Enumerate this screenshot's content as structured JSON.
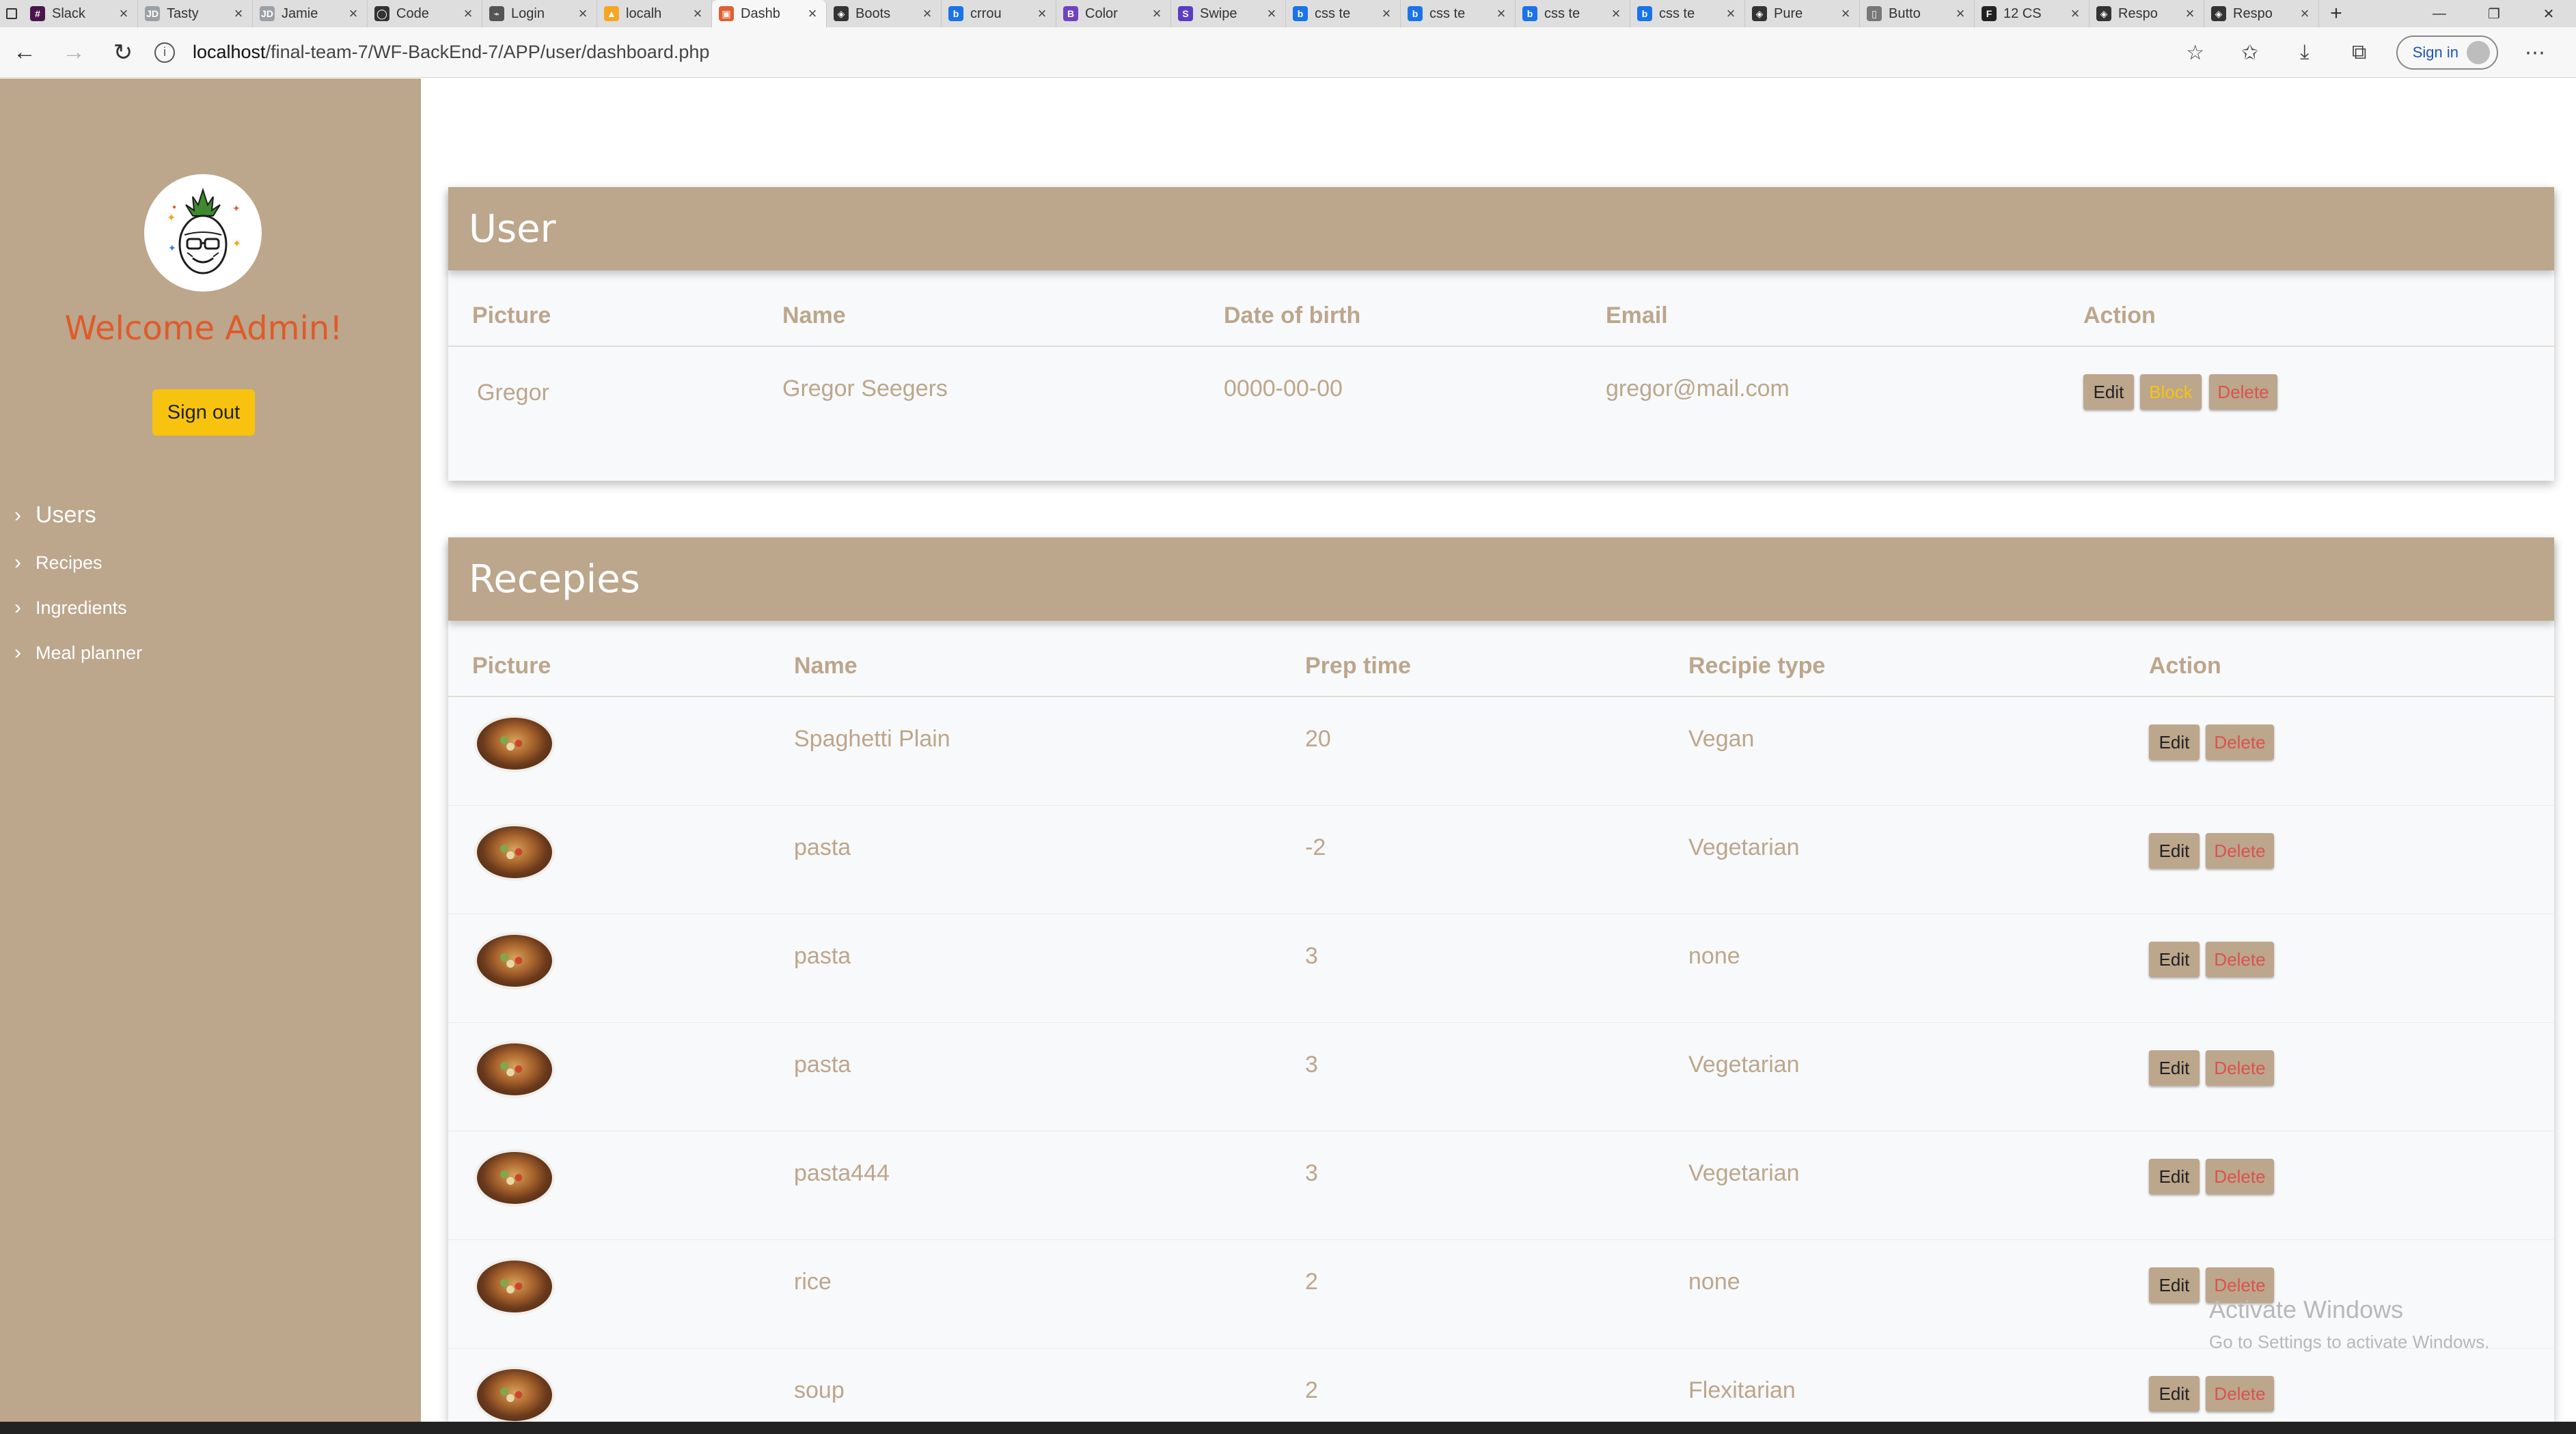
{
  "browser": {
    "tabs": [
      {
        "title": "Slack",
        "fav_color": "#4a154b",
        "fav_glyph": "#"
      },
      {
        "title": "Tasty",
        "fav_color": "#9aa0a6",
        "fav_glyph": "JD"
      },
      {
        "title": "Jamie",
        "fav_color": "#9aa0a6",
        "fav_glyph": "JD"
      },
      {
        "title": "Code",
        "fav_color": "#333333",
        "fav_glyph": "◯"
      },
      {
        "title": "Login",
        "fav_color": "#555555",
        "fav_glyph": "⌁"
      },
      {
        "title": "localh",
        "fav_color": "#f5a623",
        "fav_glyph": "▲"
      },
      {
        "title": "Dashb",
        "fav_color": "#e06030",
        "fav_glyph": "▣",
        "active": true
      },
      {
        "title": "Boots",
        "fav_color": "#333333",
        "fav_glyph": "◈"
      },
      {
        "title": "crrou",
        "fav_color": "#1a73e8",
        "fav_glyph": "b"
      },
      {
        "title": "Color",
        "fav_color": "#6f42c1",
        "fav_glyph": "B"
      },
      {
        "title": "Swipe",
        "fav_color": "#5b3cc4",
        "fav_glyph": "S"
      },
      {
        "title": "css te",
        "fav_color": "#1a73e8",
        "fav_glyph": "b"
      },
      {
        "title": "css te",
        "fav_color": "#1a73e8",
        "fav_glyph": "b"
      },
      {
        "title": "css te",
        "fav_color": "#1a73e8",
        "fav_glyph": "b"
      },
      {
        "title": "css te",
        "fav_color": "#1a73e8",
        "fav_glyph": "b"
      },
      {
        "title": "Pure",
        "fav_color": "#333333",
        "fav_glyph": "◈"
      },
      {
        "title": "Butto",
        "fav_color": "#777777",
        "fav_glyph": "▯"
      },
      {
        "title": "12 CS",
        "fav_color": "#222222",
        "fav_glyph": "F"
      },
      {
        "title": "Respo",
        "fav_color": "#333333",
        "fav_glyph": "◈"
      },
      {
        "title": "Respo",
        "fav_color": "#333333",
        "fav_glyph": "◈"
      }
    ],
    "url_host": "localhost",
    "url_path": "/final-team-7/WF-BackEnd-7/APP/user/dashboard.php",
    "signin_label": "Sign in"
  },
  "sidebar": {
    "welcome": "Welcome Admin!",
    "signout_label": "Sign out",
    "items": [
      {
        "label": "Users"
      },
      {
        "label": "Recipes"
      },
      {
        "label": "Ingredients"
      },
      {
        "label": "Meal planner"
      }
    ]
  },
  "users": {
    "title": "User",
    "headers": [
      "Picture",
      "Name",
      "Date of birth",
      "Email",
      "Action"
    ],
    "rows": [
      {
        "picture_alt": "Gregor",
        "name": "Gregor Seegers",
        "dob": "0000-00-00",
        "email": "gregor@mail.com",
        "edit": "Edit",
        "block": "Block",
        "delete": "Delete"
      }
    ]
  },
  "recipes": {
    "title": "Recepies",
    "headers": [
      "Picture",
      "Name",
      "Prep time",
      "Recipie type",
      "Action"
    ],
    "rows": [
      {
        "name": "Spaghetti Plain",
        "prep": "20",
        "type": "Vegan",
        "edit": "Edit",
        "delete": "Delete"
      },
      {
        "name": "pasta",
        "prep": "-2",
        "type": "Vegetarian",
        "edit": "Edit",
        "delete": "Delete"
      },
      {
        "name": "pasta",
        "prep": "3",
        "type": "none",
        "edit": "Edit",
        "delete": "Delete"
      },
      {
        "name": "pasta",
        "prep": "3",
        "type": "Vegetarian",
        "edit": "Edit",
        "delete": "Delete"
      },
      {
        "name": "pasta444",
        "prep": "3",
        "type": "Vegetarian",
        "edit": "Edit",
        "delete": "Delete"
      },
      {
        "name": "rice",
        "prep": "2",
        "type": "none",
        "edit": "Edit",
        "delete": "Delete"
      },
      {
        "name": "soup",
        "prep": "2",
        "type": "Flexitarian",
        "edit": "Edit",
        "delete": "Delete"
      }
    ]
  },
  "watermark": {
    "title": "Activate Windows",
    "subtitle": "Go to Settings to activate Windows."
  },
  "colors": {
    "accent": "#bca68c",
    "welcome": "#e05a2a",
    "signout": "#f8c30f",
    "delete": "#d9534f"
  }
}
